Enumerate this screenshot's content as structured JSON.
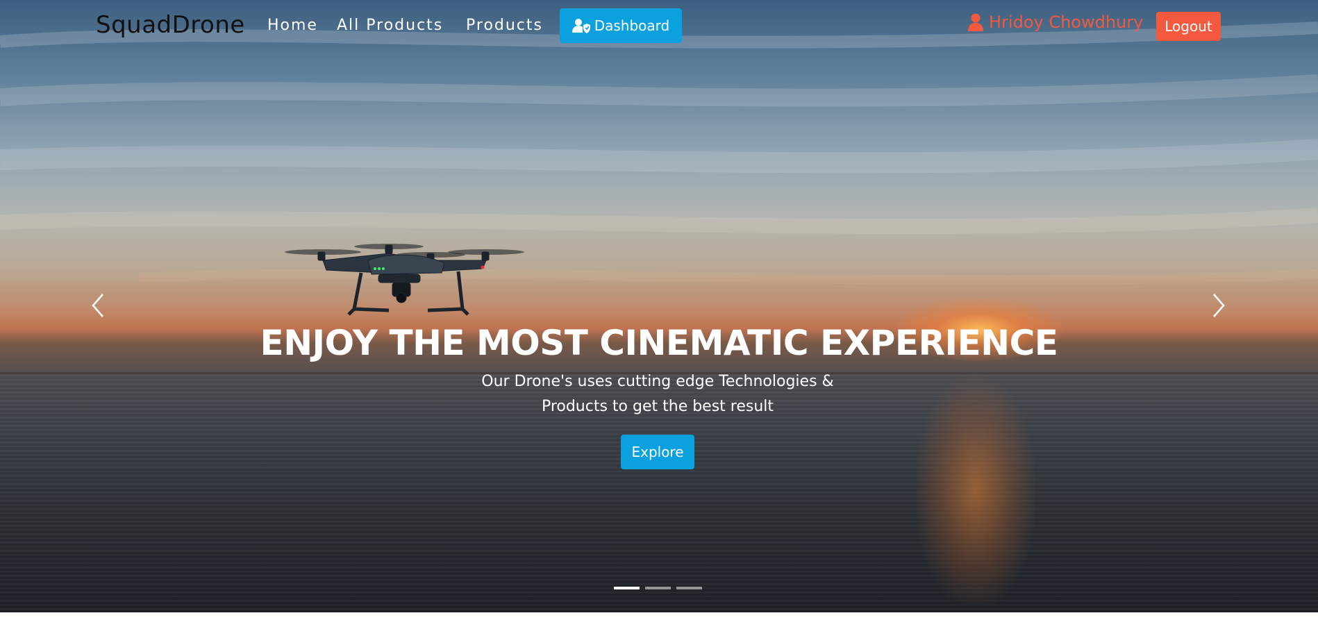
{
  "nav": {
    "brand": "SquadDrone",
    "links": [
      "Home",
      "All Products",
      "Products"
    ],
    "dashboard_label": "Dashboard",
    "user_name": "Hridoy Chowdhury",
    "logout_label": "Logout"
  },
  "hero": {
    "title": "ENJOY THE MOST CINEMATIC EXPERIENCE",
    "text": "Our Drone's uses cutting edge Technologies & Products to get the best result",
    "button_label": "Explore",
    "slides": 3,
    "active_slide": 1
  },
  "colors": {
    "primary": "#0ba1df",
    "accent": "#f2593f"
  },
  "icons": {
    "dashboard": "user-shield-icon",
    "user": "user-icon",
    "prev": "chevron-left-icon",
    "next": "chevron-right-icon"
  }
}
